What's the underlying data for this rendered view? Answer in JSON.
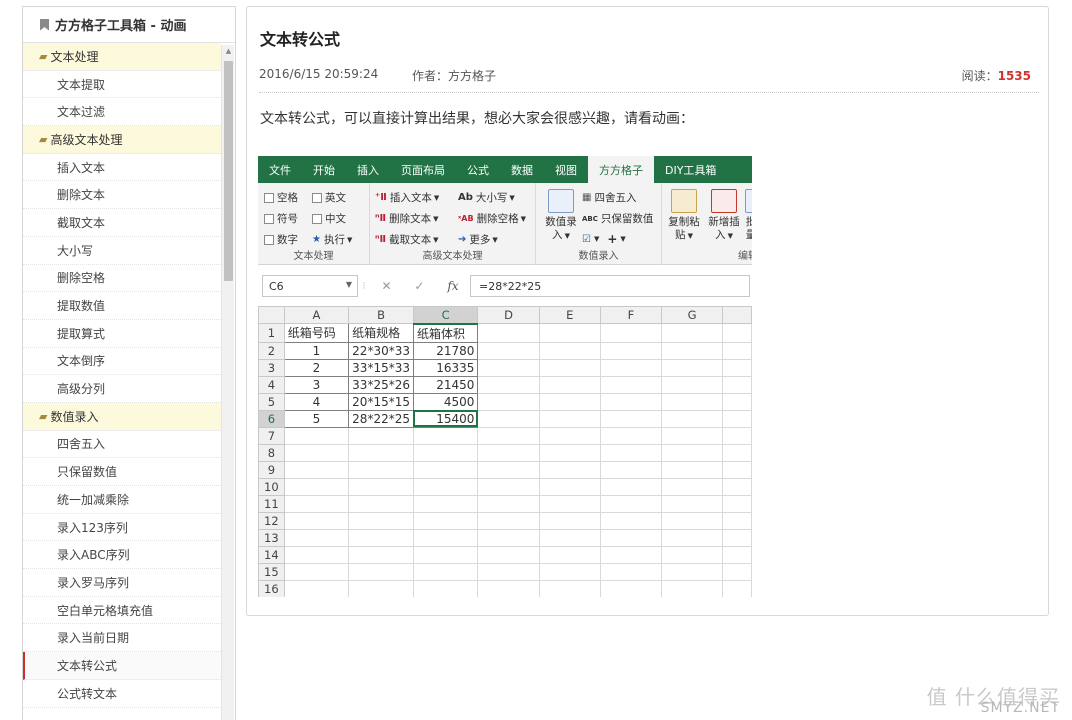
{
  "sidebar": {
    "title": "方方格子工具箱 - 动画",
    "entries": [
      {
        "type": "group",
        "label": "文本处理"
      },
      {
        "type": "item",
        "label": "文本提取"
      },
      {
        "type": "item",
        "label": "文本过滤"
      },
      {
        "type": "group",
        "label": "高级文本处理"
      },
      {
        "type": "item",
        "label": "插入文本"
      },
      {
        "type": "item",
        "label": "删除文本"
      },
      {
        "type": "item",
        "label": "截取文本"
      },
      {
        "type": "item",
        "label": "大小写"
      },
      {
        "type": "item",
        "label": "删除空格"
      },
      {
        "type": "item",
        "label": "提取数值"
      },
      {
        "type": "item",
        "label": "提取算式"
      },
      {
        "type": "item",
        "label": "文本倒序"
      },
      {
        "type": "item",
        "label": "高级分列"
      },
      {
        "type": "group",
        "label": "数值录入"
      },
      {
        "type": "item",
        "label": "四舍五入"
      },
      {
        "type": "item",
        "label": "只保留数值"
      },
      {
        "type": "item",
        "label": "统一加减乘除"
      },
      {
        "type": "item",
        "label": "录入123序列"
      },
      {
        "type": "item",
        "label": "录入ABC序列"
      },
      {
        "type": "item",
        "label": "录入罗马序列"
      },
      {
        "type": "item",
        "label": "空白单元格填充值"
      },
      {
        "type": "item",
        "label": "录入当前日期"
      },
      {
        "type": "item",
        "label": "文本转公式",
        "active": true
      },
      {
        "type": "item",
        "label": "公式转文本"
      }
    ]
  },
  "article": {
    "title": "文本转公式",
    "date": "2016/6/15 20:59:24",
    "author": "作者：方方格子",
    "reads_label": "阅读：",
    "reads_count": "1535",
    "intro": "文本转公式，可以直接计算出结果，想必大家会很感兴趣，请看动画："
  },
  "excel": {
    "tabs": [
      "文件",
      "开始",
      "插入",
      "页面布局",
      "公式",
      "数据",
      "视图",
      "方方格子",
      "DIY工具箱"
    ],
    "active_tab": "方方格子",
    "ribbon": {
      "text_group": {
        "label": "文本处理",
        "options": [
          "空格",
          "英文",
          "符号",
          "中文",
          "数字"
        ],
        "exec": "执行"
      },
      "adv_group": {
        "label": "高级文本处理",
        "insert": "插入文本",
        "delete": "删除文本",
        "cut": "截取文本",
        "case": "大小写",
        "del_space": "删除空格",
        "more": "更多"
      },
      "num_group": {
        "label": "数值录入",
        "entry_line1": "数值录",
        "entry_line2": "入",
        "round": "四舍五入",
        "keep": "只保留数值"
      },
      "edit_group": {
        "label": "编辑",
        "copy1": "复制粘",
        "copy2": "贴",
        "newins1": "新增插",
        "newins2": "入",
        "extra1": "批",
        "extra2": "量"
      }
    },
    "namebox": "C6",
    "formula": "=28*22*25",
    "col_headers": [
      "A",
      "B",
      "C",
      "D",
      "E",
      "F",
      "G"
    ],
    "rows": [
      [
        "纸箱号码",
        "纸箱规格",
        "纸箱体积"
      ],
      [
        "1",
        "22*30*33",
        "21780"
      ],
      [
        "2",
        "33*15*33",
        "16335"
      ],
      [
        "3",
        "33*25*26",
        "21450"
      ],
      [
        "4",
        "20*15*15",
        "4500"
      ],
      [
        "5",
        "28*22*25",
        "15400"
      ]
    ],
    "row_numbers": [
      "1",
      "2",
      "3",
      "4",
      "5",
      "6",
      "7",
      "8",
      "9",
      "10",
      "11",
      "12",
      "13",
      "14",
      "15",
      "16"
    ]
  },
  "watermark": {
    "text": "值 什么值得买",
    "brand": "SMYZ.NET"
  }
}
